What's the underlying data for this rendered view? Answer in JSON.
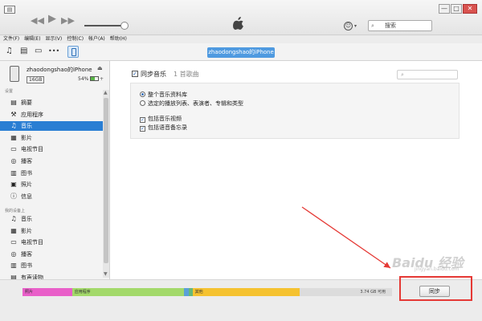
{
  "window": {
    "app_menu_glyph": "▤",
    "min_glyph": "—",
    "max_glyph": "□",
    "close_glyph": "✕"
  },
  "player": {
    "prev_icon": "rewind-icon",
    "play_icon": "play-icon",
    "next_icon": "fast-forward-icon",
    "prev_glyph": "◀◀",
    "play_glyph": "▶",
    "next_glyph": "▶▶",
    "account_glyph": "☺",
    "account_caret": "▾",
    "search_icon": "search-icon",
    "search_glyph": "⌕",
    "search_placeholder": "搜索"
  },
  "menu": [
    "文件(F)",
    "编辑(E)",
    "显示(V)",
    "控制(C)",
    "帐户(A)",
    "帮助(H)"
  ],
  "toolbar": {
    "music_icon": "♫",
    "movies_icon": "▤",
    "tv_icon": "▭",
    "more_icon": "•••",
    "device_name": "zhaodongshao的iPhone"
  },
  "device": {
    "name": "zhaodongshao的iPhone",
    "capacity": "16GB",
    "battery": "54%",
    "battery_level": 0.54,
    "eject_glyph": "⏏",
    "plus_glyph": "+"
  },
  "sidebar": {
    "settings_header": "设置",
    "settings": [
      {
        "icon": "▤",
        "label": "摘要",
        "selected": false
      },
      {
        "icon": "⚒",
        "label": "应用程序",
        "selected": false
      },
      {
        "icon": "♫",
        "label": "音乐",
        "selected": true
      },
      {
        "icon": "▦",
        "label": "影片",
        "selected": false
      },
      {
        "icon": "▭",
        "label": "电视节目",
        "selected": false
      },
      {
        "icon": "◎",
        "label": "播客",
        "selected": false
      },
      {
        "icon": "▥",
        "label": "图书",
        "selected": false
      },
      {
        "icon": "▣",
        "label": "照片",
        "selected": false
      },
      {
        "icon": "ⓘ",
        "label": "信息",
        "selected": false
      }
    ],
    "ondevice_header": "我的设备上",
    "ondevice": [
      {
        "icon": "♫",
        "label": "音乐"
      },
      {
        "icon": "▦",
        "label": "影片"
      },
      {
        "icon": "▭",
        "label": "电视节目"
      },
      {
        "icon": "◎",
        "label": "播客"
      },
      {
        "icon": "▥",
        "label": "图书"
      },
      {
        "icon": "▤",
        "label": "有声读物"
      }
    ]
  },
  "main": {
    "sync_checked": true,
    "sync_title": "同步音乐",
    "sync_count": "1 首歌曲",
    "filter_glyph": "⌕",
    "options": [
      {
        "type": "radio",
        "checked": true,
        "label": "整个音乐资料库"
      },
      {
        "type": "radio",
        "checked": false,
        "label": "选定的播放列表、表演者、专辑和类型"
      },
      {
        "type": "checkbox",
        "checked": true,
        "label": "包括音乐视频"
      },
      {
        "type": "checkbox",
        "checked": true,
        "label": "包括语音备忘录"
      }
    ]
  },
  "capacity_bar": {
    "segments": [
      {
        "label": "照片",
        "color": "#e95fc9",
        "fraction": 0.134
      },
      {
        "label": "应用程序",
        "color": "#a3d96a",
        "fraction": 0.304
      },
      {
        "label": "",
        "color": "#5aa0d8",
        "fraction": 0.011
      },
      {
        "label": "",
        "color": "#66b87a",
        "fraction": 0.011
      },
      {
        "label": "其他",
        "color": "#f5c230",
        "fraction": 0.29
      }
    ],
    "free_label": "3.74 GB 可用",
    "free_color": "#dcdcdc"
  },
  "sync_button_label": "同步",
  "watermark": "Baidu 经验",
  "watermark_sub": "jingyan.baidu.com",
  "colors": {
    "selection": "#2a7ed3",
    "device_pill": "#4f9ae0",
    "annotation": "#e53935"
  }
}
